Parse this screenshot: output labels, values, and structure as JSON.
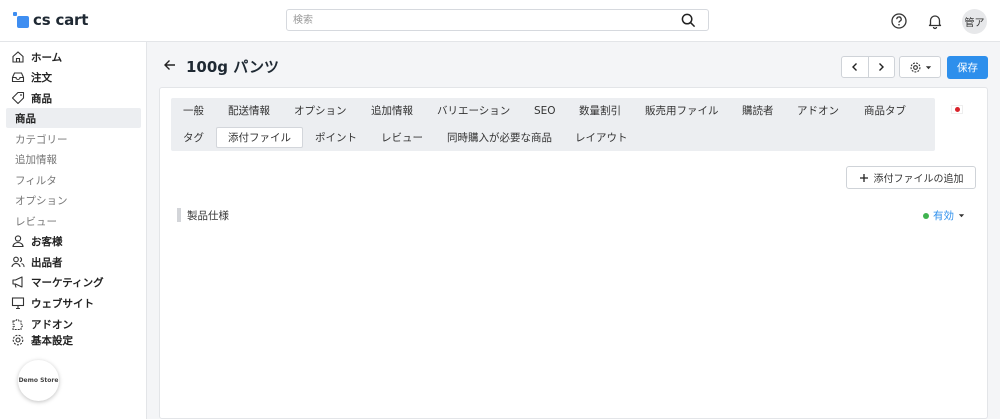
{
  "brand": {
    "name": "cs cart"
  },
  "search": {
    "placeholder": "検索"
  },
  "user": {
    "avatar_text": "管ア"
  },
  "sidebar": {
    "items": [
      {
        "label": "ホーム"
      },
      {
        "label": "注文"
      },
      {
        "label": "商品"
      },
      {
        "label": "商品"
      },
      {
        "label": "カテゴリー"
      },
      {
        "label": "追加情報"
      },
      {
        "label": "フィルタ"
      },
      {
        "label": "オプション"
      },
      {
        "label": "レビュー"
      },
      {
        "label": "お客様"
      },
      {
        "label": "出品者"
      },
      {
        "label": "マーケティング"
      },
      {
        "label": "ウェブサイト"
      },
      {
        "label": "アドオン"
      },
      {
        "label": "基本設定"
      }
    ],
    "store_badge": "Demo Store"
  },
  "page": {
    "title": "100g パンツ",
    "save_label": "保存"
  },
  "tabs": [
    {
      "label": "一般"
    },
    {
      "label": "配送情報"
    },
    {
      "label": "オプション"
    },
    {
      "label": "追加情報"
    },
    {
      "label": "バリエーション"
    },
    {
      "label": "SEO"
    },
    {
      "label": "数量割引"
    },
    {
      "label": "販売用ファイル"
    },
    {
      "label": "購読者"
    },
    {
      "label": "アドオン"
    },
    {
      "label": "商品タブ"
    },
    {
      "label": "タグ"
    },
    {
      "label": "添付ファイル"
    },
    {
      "label": "ポイント"
    },
    {
      "label": "レビュー"
    },
    {
      "label": "同時購入が必要な商品"
    },
    {
      "label": "レイアウト"
    }
  ],
  "active_tab": "添付ファイル",
  "attachments": {
    "add_label": "添付ファイルの追加",
    "rows": [
      {
        "name": "製品仕様",
        "status": "有効"
      }
    ]
  },
  "colors": {
    "accent": "#2d8fec",
    "status_active": "#3fb34f",
    "logo": "#3f8ef1"
  }
}
